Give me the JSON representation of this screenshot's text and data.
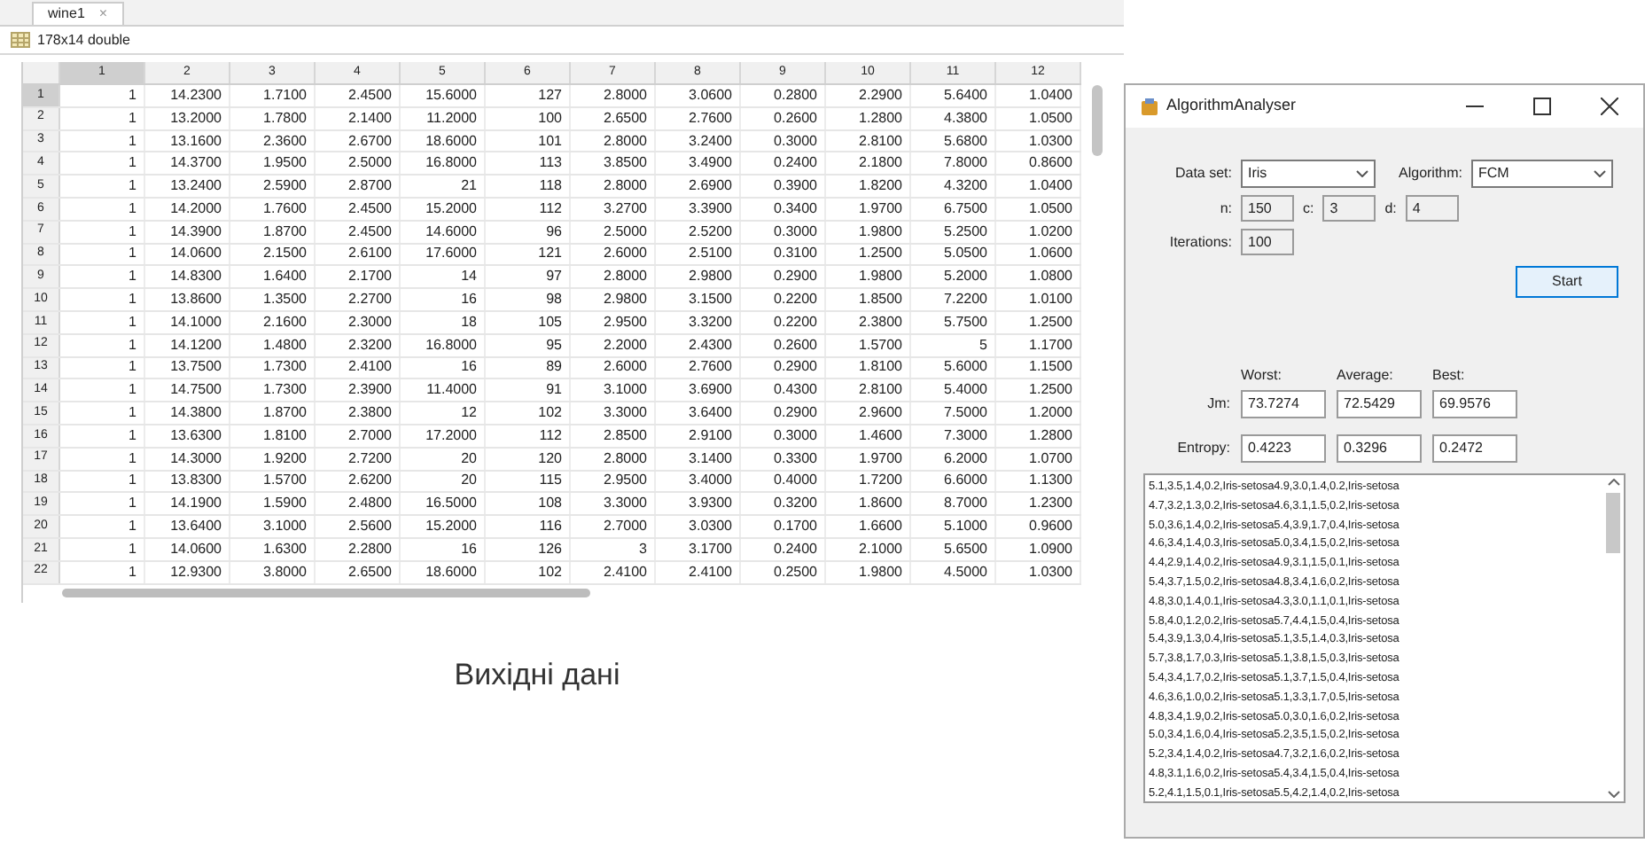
{
  "variable_editor": {
    "tabs": [
      {
        "label": "wine1",
        "close": "×",
        "selected": true
      }
    ],
    "size_label": "178x14 double",
    "columns": [
      {
        "label": "1",
        "selected": true
      },
      {
        "label": "2",
        "selected": false
      },
      {
        "label": "3",
        "selected": false
      },
      {
        "label": "4",
        "selected": false
      },
      {
        "label": "5",
        "selected": false
      },
      {
        "label": "6",
        "selected": false
      },
      {
        "label": "7",
        "selected": false
      },
      {
        "label": "8",
        "selected": false
      },
      {
        "label": "9",
        "selected": false
      },
      {
        "label": "10",
        "selected": false
      },
      {
        "label": "11",
        "selected": false
      },
      {
        "label": "12",
        "selected": false
      }
    ],
    "rows": [
      {
        "label": "1",
        "selected": true,
        "cells": [
          "1",
          "14.2300",
          "1.7100",
          "2.4500",
          "15.6000",
          "127",
          "2.8000",
          "3.0600",
          "0.2800",
          "2.2900",
          "5.6400",
          "1.0400"
        ]
      },
      {
        "label": "2",
        "selected": false,
        "cells": [
          "1",
          "13.2000",
          "1.7800",
          "2.1400",
          "11.2000",
          "100",
          "2.6500",
          "2.7600",
          "0.2600",
          "1.2800",
          "4.3800",
          "1.0500"
        ]
      },
      {
        "label": "3",
        "selected": false,
        "cells": [
          "1",
          "13.1600",
          "2.3600",
          "2.6700",
          "18.6000",
          "101",
          "2.8000",
          "3.2400",
          "0.3000",
          "2.8100",
          "5.6800",
          "1.0300"
        ]
      },
      {
        "label": "4",
        "selected": false,
        "cells": [
          "1",
          "14.3700",
          "1.9500",
          "2.5000",
          "16.8000",
          "113",
          "3.8500",
          "3.4900",
          "0.2400",
          "2.1800",
          "7.8000",
          "0.8600"
        ]
      },
      {
        "label": "5",
        "selected": false,
        "cells": [
          "1",
          "13.2400",
          "2.5900",
          "2.8700",
          "21",
          "118",
          "2.8000",
          "2.6900",
          "0.3900",
          "1.8200",
          "4.3200",
          "1.0400"
        ]
      },
      {
        "label": "6",
        "selected": false,
        "cells": [
          "1",
          "14.2000",
          "1.7600",
          "2.4500",
          "15.2000",
          "112",
          "3.2700",
          "3.3900",
          "0.3400",
          "1.9700",
          "6.7500",
          "1.0500"
        ]
      },
      {
        "label": "7",
        "selected": false,
        "cells": [
          "1",
          "14.3900",
          "1.8700",
          "2.4500",
          "14.6000",
          "96",
          "2.5000",
          "2.5200",
          "0.3000",
          "1.9800",
          "5.2500",
          "1.0200"
        ]
      },
      {
        "label": "8",
        "selected": false,
        "cells": [
          "1",
          "14.0600",
          "2.1500",
          "2.6100",
          "17.6000",
          "121",
          "2.6000",
          "2.5100",
          "0.3100",
          "1.2500",
          "5.0500",
          "1.0600"
        ]
      },
      {
        "label": "9",
        "selected": false,
        "cells": [
          "1",
          "14.8300",
          "1.6400",
          "2.1700",
          "14",
          "97",
          "2.8000",
          "2.9800",
          "0.2900",
          "1.9800",
          "5.2000",
          "1.0800"
        ]
      },
      {
        "label": "10",
        "selected": false,
        "cells": [
          "1",
          "13.8600",
          "1.3500",
          "2.2700",
          "16",
          "98",
          "2.9800",
          "3.1500",
          "0.2200",
          "1.8500",
          "7.2200",
          "1.0100"
        ]
      },
      {
        "label": "11",
        "selected": false,
        "cells": [
          "1",
          "14.1000",
          "2.1600",
          "2.3000",
          "18",
          "105",
          "2.9500",
          "3.3200",
          "0.2200",
          "2.3800",
          "5.7500",
          "1.2500"
        ]
      },
      {
        "label": "12",
        "selected": false,
        "cells": [
          "1",
          "14.1200",
          "1.4800",
          "2.3200",
          "16.8000",
          "95",
          "2.2000",
          "2.4300",
          "0.2600",
          "1.5700",
          "5",
          "1.1700"
        ]
      },
      {
        "label": "13",
        "selected": false,
        "cells": [
          "1",
          "13.7500",
          "1.7300",
          "2.4100",
          "16",
          "89",
          "2.6000",
          "2.7600",
          "0.2900",
          "1.8100",
          "5.6000",
          "1.1500"
        ]
      },
      {
        "label": "14",
        "selected": false,
        "cells": [
          "1",
          "14.7500",
          "1.7300",
          "2.3900",
          "11.4000",
          "91",
          "3.1000",
          "3.6900",
          "0.4300",
          "2.8100",
          "5.4000",
          "1.2500"
        ]
      },
      {
        "label": "15",
        "selected": false,
        "cells": [
          "1",
          "14.3800",
          "1.8700",
          "2.3800",
          "12",
          "102",
          "3.3000",
          "3.6400",
          "0.2900",
          "2.9600",
          "7.5000",
          "1.2000"
        ]
      },
      {
        "label": "16",
        "selected": false,
        "cells": [
          "1",
          "13.6300",
          "1.8100",
          "2.7000",
          "17.2000",
          "112",
          "2.8500",
          "2.9100",
          "0.3000",
          "1.4600",
          "7.3000",
          "1.2800"
        ]
      },
      {
        "label": "17",
        "selected": false,
        "cells": [
          "1",
          "14.3000",
          "1.9200",
          "2.7200",
          "20",
          "120",
          "2.8000",
          "3.1400",
          "0.3300",
          "1.9700",
          "6.2000",
          "1.0700"
        ]
      },
      {
        "label": "18",
        "selected": false,
        "cells": [
          "1",
          "13.8300",
          "1.5700",
          "2.6200",
          "20",
          "115",
          "2.9500",
          "3.4000",
          "0.4000",
          "1.7200",
          "6.6000",
          "1.1300"
        ]
      },
      {
        "label": "19",
        "selected": false,
        "cells": [
          "1",
          "14.1900",
          "1.5900",
          "2.4800",
          "16.5000",
          "108",
          "3.3000",
          "3.9300",
          "0.3200",
          "1.8600",
          "8.7000",
          "1.2300"
        ]
      },
      {
        "label": "20",
        "selected": false,
        "cells": [
          "1",
          "13.6400",
          "3.1000",
          "2.5600",
          "15.2000",
          "116",
          "2.7000",
          "3.0300",
          "0.1700",
          "1.6600",
          "5.1000",
          "0.9600"
        ]
      },
      {
        "label": "21",
        "selected": false,
        "cells": [
          "1",
          "14.0600",
          "1.6300",
          "2.2800",
          "16",
          "126",
          "3",
          "3.1700",
          "0.2400",
          "2.1000",
          "5.6500",
          "1.0900"
        ]
      },
      {
        "label": "22",
        "selected": false,
        "cells": [
          "1",
          "12.9300",
          "3.8000",
          "2.6500",
          "18.6000",
          "102",
          "2.4100",
          "2.4100",
          "0.2500",
          "1.9800",
          "4.5000",
          "1.0300"
        ]
      }
    ]
  },
  "caption": "Вихідні дані",
  "dialog": {
    "title": "AlgorithmAnalyser",
    "data_set": {
      "label": "Data set:",
      "value": "Iris"
    },
    "algorithm": {
      "label": "Algorithm:",
      "value": "FCM"
    },
    "params": [
      {
        "label": "n:",
        "value": "150"
      },
      {
        "label": "c:",
        "value": "3"
      },
      {
        "label": "d:",
        "value": "4"
      }
    ],
    "iterations": {
      "label": "Iterations:",
      "value": "100"
    },
    "start_button": "Start",
    "result_columns": [
      "Worst:",
      "Average:",
      "Best:"
    ],
    "results": [
      {
        "label": "Jm:",
        "values": [
          "73.7274",
          "72.5429",
          "69.9576"
        ]
      },
      {
        "label": "Entropy:",
        "values": [
          "0.4223",
          "0.3296",
          "0.2472"
        ]
      }
    ],
    "list": [
      "5.1,3.5,1.4,0.2,Iris-setosa4.9,3.0,1.4,0.2,Iris-setosa",
      "4.7,3.2,1.3,0.2,Iris-setosa4.6,3.1,1.5,0.2,Iris-setosa",
      "5.0,3.6,1.4,0.2,Iris-setosa5.4,3.9,1.7,0.4,Iris-setosa",
      "4.6,3.4,1.4,0.3,Iris-setosa5.0,3.4,1.5,0.2,Iris-setosa",
      "4.4,2.9,1.4,0.2,Iris-setosa4.9,3.1,1.5,0.1,Iris-setosa",
      "5.4,3.7,1.5,0.2,Iris-setosa4.8,3.4,1.6,0.2,Iris-setosa",
      "4.8,3.0,1.4,0.1,Iris-setosa4.3,3.0,1.1,0.1,Iris-setosa",
      "5.8,4.0,1.2,0.2,Iris-setosa5.7,4.4,1.5,0.4,Iris-setosa",
      "5.4,3.9,1.3,0.4,Iris-setosa5.1,3.5,1.4,0.3,Iris-setosa",
      "5.7,3.8,1.7,0.3,Iris-setosa5.1,3.8,1.5,0.3,Iris-setosa",
      "5.4,3.4,1.7,0.2,Iris-setosa5.1,3.7,1.5,0.4,Iris-setosa",
      "4.6,3.6,1.0,0.2,Iris-setosa5.1,3.3,1.7,0.5,Iris-setosa",
      "4.8,3.4,1.9,0.2,Iris-setosa5.0,3.0,1.6,0.2,Iris-setosa",
      "5.0,3.4,1.6,0.4,Iris-setosa5.2,3.5,1.5,0.2,Iris-setosa",
      "5.2,3.4,1.4,0.2,Iris-setosa4.7,3.2,1.6,0.2,Iris-setosa",
      "4.8,3.1,1.6,0.2,Iris-setosa5.4,3.4,1.5,0.4,Iris-setosa",
      "5.2,4.1,1.5,0.1,Iris-setosa5.5,4.2,1.4,0.2,Iris-setosa"
    ]
  }
}
